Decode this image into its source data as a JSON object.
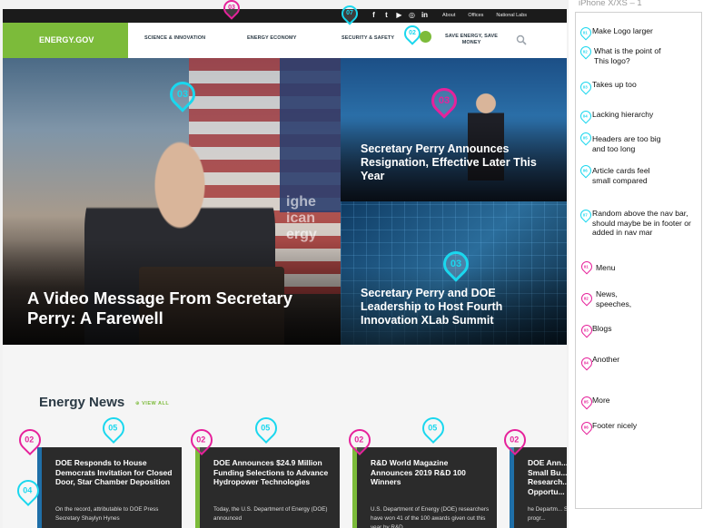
{
  "artboard_title": "iPhone X/XS – 1",
  "site": {
    "utility_icons": [
      "facebook-icon",
      "twitter-icon",
      "youtube-icon",
      "instagram-icon",
      "linkedin-icon"
    ],
    "utility_icon_glyphs": [
      "f",
      "t",
      "▶",
      "◎",
      "in"
    ],
    "utility_links": [
      "About",
      "Offices",
      "National Labs"
    ],
    "logo": "ENERGY.GOV",
    "nav": [
      "SCIENCE & INNOVATION",
      "ENERGY ECONOMY",
      "SECURITY & SAFETY"
    ],
    "nav_save_line1": "SAVE ENERGY, SAVE",
    "nav_save_line2": "MONEY",
    "hero_main_title": "A Video Message From Secretary Perry: A Farewell",
    "hero_main_sign": "ighe\nican\nergy",
    "hero_top_title": "Secretary Perry Announces Resignation, Effective Later This Year",
    "hero_bottom_title": "Secretary Perry and DOE Leadership to Host Fourth Innovation XLab Summit",
    "news_heading": "Energy News",
    "news_viewall": "VIEW ALL",
    "news_cards": [
      {
        "title": "DOE Responds to House Democrats Invitation for Closed Door, Star Chamber Deposition",
        "text": "On the record, attributable to DOE Press Secretary Shaylyn Hynes"
      },
      {
        "title": "DOE Announces $24.9 Million Funding Selections to Advance Hydropower Technologies",
        "text": "Today, the U.S. Department of Energy (DOE) announced"
      },
      {
        "title": "R&D World Magazine Announces 2019 R&D 100 Winners",
        "text": "U.S. Department of Energy (DOE) researchers have won 41 of the 100 awards given out this year by R&D"
      },
      {
        "title": "DOE Ann... Small Bu... Research... Opportu...",
        "text": "he Departm... STTR progr..."
      }
    ]
  },
  "markers": {
    "m_top": "03",
    "m_util": "07",
    "m_nav": "02",
    "m_hero_main": "03",
    "m_hero_top": "03",
    "m_hero_bottom": "03",
    "m_news_02a": "02",
    "m_news_05a": "05",
    "m_news_04": "04",
    "m_news_02b": "02",
    "m_news_05b": "05",
    "m_news_02c": "02",
    "m_news_05c": "05",
    "m_news_02d": "02"
  },
  "notes_cyan": [
    {
      "num": "01",
      "text": "Make Logo larger"
    },
    {
      "num": "02",
      "text": "What is the point of This logo?"
    },
    {
      "num": "03",
      "text": "Takes up too"
    },
    {
      "num": "04",
      "text": "Lacking hierarchy"
    },
    {
      "num": "05",
      "text": "Headers are too big and too long"
    },
    {
      "num": "06",
      "text": "Article cards feel small compared"
    },
    {
      "num": "07",
      "text": "Random above the nav bar, should maybe be in footer or added in nav mar"
    }
  ],
  "notes_magenta": [
    {
      "num": "01",
      "text": "Menu"
    },
    {
      "num": "02",
      "text": "News, speeches,"
    },
    {
      "num": "03",
      "text": "Blogs"
    },
    {
      "num": "04",
      "text": "Another"
    },
    {
      "num": "05",
      "text": "More"
    },
    {
      "num": "06",
      "text": "Footer nicely"
    }
  ],
  "colors": {
    "brand_green": "#7cbb3a",
    "marker_cyan": "#1ad7ee",
    "marker_magenta": "#e6229b",
    "navy": "#2b3a45"
  }
}
